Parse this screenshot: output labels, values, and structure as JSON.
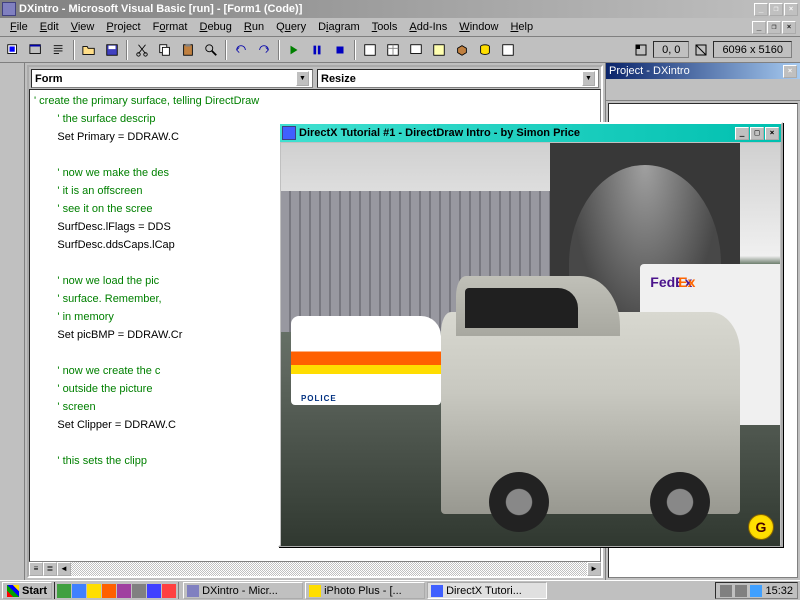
{
  "app": {
    "title": "DXintro - Microsoft Visual Basic [run] - [Form1 (Code)]"
  },
  "menu": {
    "file": "File",
    "edit": "Edit",
    "view": "View",
    "project": "Project",
    "format": "Format",
    "debug": "Debug",
    "run": "Run",
    "query": "Query",
    "diagram": "Diagram",
    "tools": "Tools",
    "addins": "Add-Ins",
    "window": "Window",
    "help": "Help"
  },
  "toolbar_coords": {
    "pos": "0, 0",
    "size": "6096 x 5160"
  },
  "code_dropdowns": {
    "object": "Form",
    "proc": "Resize"
  },
  "code": {
    "l1": "' create the primary surface, telling DirectDraw",
    "l2": "' the surface descrip",
    "l3": "Set Primary = DDRAW.C",
    "l4": "",
    "l5": "' now we make the des",
    "l6": "' it is an offscreen ",
    "l7": "' see it on the scree",
    "l8": "SurfDesc.lFlags = DDS",
    "l9": "SurfDesc.ddsCaps.lCap",
    "l10": "",
    "l11": "' now we load the pic",
    "l12": "' surface. Remember, ",
    "l13": "' in memory",
    "l14": "Set picBMP = DDRAW.Cr",
    "l15": "",
    "l16": "' now we create the c",
    "l17": "' outside the picture",
    "l18": "' screen",
    "l19": "Set Clipper = DDRAW.C",
    "l20": "",
    "l21": "' this sets the clipp"
  },
  "project_pane": {
    "title": "Project - DXintro"
  },
  "dx_window": {
    "title": "DirectX Tutorial #1 - DirectDraw Intro - by Simon Price",
    "badge": "G",
    "van_brand": "FedEx",
    "police_label": "POLICE"
  },
  "taskbar": {
    "start": "Start",
    "tasks": {
      "t1": "DXintro - Micr...",
      "t2": "iPhoto Plus - [...",
      "t3": "DirectX Tutori..."
    },
    "clock": "15:32"
  }
}
